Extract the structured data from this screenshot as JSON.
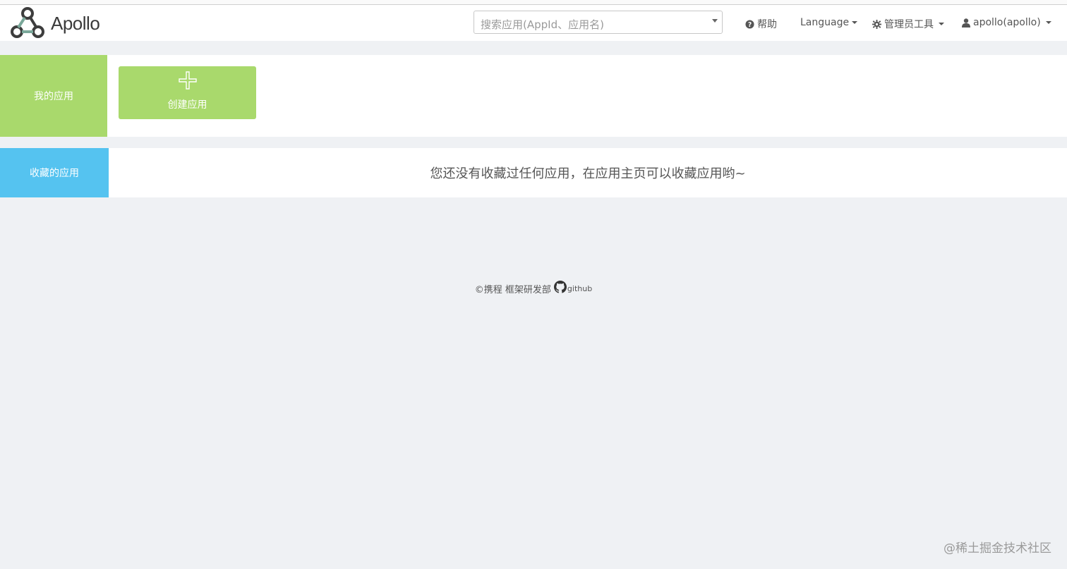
{
  "app": {
    "brand_name": "Apollo"
  },
  "search": {
    "placeholder": "搜索应用(AppId、应用名)"
  },
  "nav": {
    "help_label": "帮助",
    "language_label": "Language",
    "admin_tools_label": "管理员工具",
    "user_label": "apollo(apollo)"
  },
  "my_apps": {
    "title": "我的应用",
    "create_label": "创建应用",
    "accent_color": "#a9d96c"
  },
  "favorite_apps": {
    "title": "收藏的应用",
    "empty_message": "您还没有收藏过任何应用，在应用主页可以收藏应用哟~",
    "accent_color": "#55c3f0"
  },
  "footer": {
    "copyright_text": "©携程 框架研发部",
    "github_label": "github"
  },
  "watermark": "@稀土掘金技术社区"
}
